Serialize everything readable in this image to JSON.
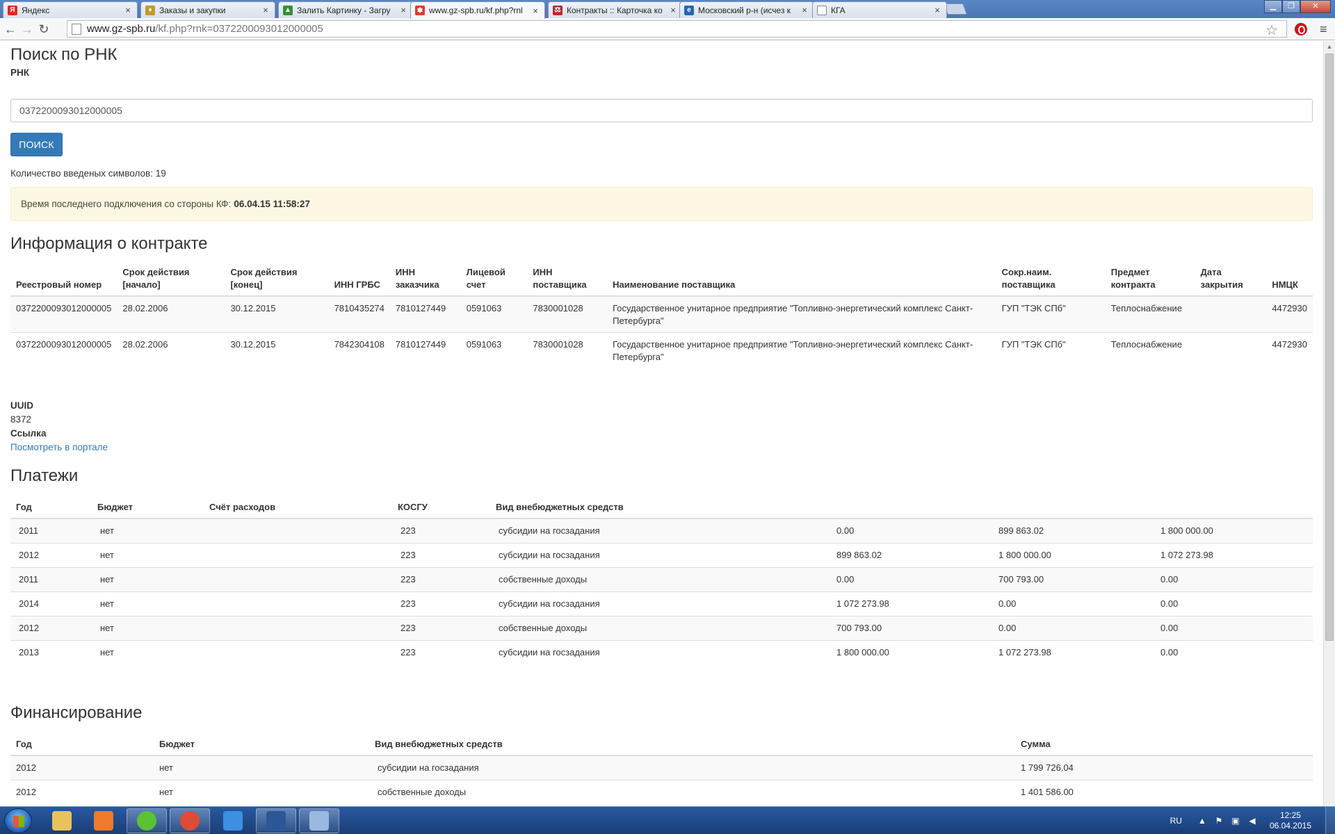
{
  "browser": {
    "tabs": [
      {
        "title": "Яндекс",
        "favicon_color": "#e52620",
        "favicon_char": "Я",
        "active": false
      },
      {
        "title": "Заказы и закупки",
        "favicon_color": "#c49a2c",
        "favicon_char": "♦",
        "active": false
      },
      {
        "title": "Залить Картинку - Загру",
        "favicon_color": "#3a8c3a",
        "favicon_char": "▲",
        "active": false
      },
      {
        "title": "www.gz-spb.ru/kf.php?rnl",
        "favicon_color": "#d6402b",
        "favicon_char": "✽",
        "active": true
      },
      {
        "title": "Контракты :: Карточка ко",
        "favicon_color": "#b03030",
        "favicon_char": "⚖",
        "active": false
      },
      {
        "title": "Московский р-н (исчез к",
        "favicon_color": "#2766b0",
        "favicon_char": "e",
        "active": false
      },
      {
        "title": "КГА",
        "favicon_color": "#ffffff",
        "favicon_char": "",
        "active": false
      }
    ],
    "url_host": "www.gz-spb.ru",
    "url_path": "/kf.php?rnk=0372200093012000005",
    "back_icon": "arrow-left-icon",
    "forward_icon": "arrow-right-icon",
    "reload_icon": "reload-icon"
  },
  "search": {
    "title": "Поиск по РНК",
    "field_label": "РНК",
    "value": "0372200093012000005",
    "button_label": "ПОИСК",
    "counter_text": "Количество введеных символов: 19",
    "alert_text": "Время последнего подключения со стороны КФ:",
    "alert_time": "06.04.15 11:58:27"
  },
  "contract": {
    "title": "Информация о контракте",
    "headers": {
      "reg": "Реестровый номер",
      "start_1": "Срок действия",
      "start_2": "[начало]",
      "end_1": "Срок действия",
      "end_2": "[конец]",
      "inn_grbs": "ИНН ГРБС",
      "inn_cust_1": "ИНН",
      "inn_cust_2": "заказчика",
      "account_1": "Лицевой",
      "account_2": "счет",
      "inn_sup_1": "ИНН",
      "inn_sup_2": "поставщика",
      "sup_name": "Наименование поставщика",
      "sup_short_1": "Сокр.наим.",
      "sup_short_2": "поставщика",
      "subject_1": "Предмет",
      "subject_2": "контракта",
      "close_1": "Дата",
      "close_2": "закрытия",
      "nmck": "НМЦК"
    },
    "rows": [
      {
        "reg": "0372200093012000005",
        "start": "28.02.2006",
        "end": "30.12.2015",
        "inn_grbs": "7810435274",
        "inn_cust": "7810127449",
        "account": "0591063",
        "inn_sup": "7830001028",
        "sup_name": "Государственное унитарное предприятие \"Топливно-энергетический комплекс Санкт-Петербурга\"",
        "sup_short": "ГУП \"ТЭК СПб\"",
        "subject": "Теплоснабжение",
        "close": "",
        "nmck": "4472930"
      },
      {
        "reg": "0372200093012000005",
        "start": "28.02.2006",
        "end": "30.12.2015",
        "inn_grbs": "7842304108",
        "inn_cust": "7810127449",
        "account": "0591063",
        "inn_sup": "7830001028",
        "sup_name": "Государственное унитарное предприятие \"Топливно-энергетический комплекс Санкт-Петербурга\"",
        "sup_short": "ГУП \"ТЭК СПб\"",
        "subject": "Теплоснабжение",
        "close": "",
        "nmck": "4472930"
      }
    ],
    "uuid_label": "UUID",
    "uuid_value": "8372",
    "link_label": "Ссылка",
    "link_text": "Посмотреть в портале"
  },
  "payments": {
    "title": "Платежи",
    "headers": {
      "year": "Год",
      "budget": "Бюджет",
      "account": "Счёт расходов",
      "kosgu": "КОСГУ",
      "kind": "Вид внебюджетных средств",
      "c6": "",
      "c7": "",
      "c8": ""
    },
    "rows": [
      {
        "year": "2011",
        "budget": "нет",
        "account": "",
        "kosgu": "223",
        "kind": "субсидии на госзадания",
        "c6": "0.00",
        "c7": "899 863.02",
        "c8": "1 800 000.00"
      },
      {
        "year": "2012",
        "budget": "нет",
        "account": "",
        "kosgu": "223",
        "kind": "субсидии на госзадания",
        "c6": "899 863.02",
        "c7": "1 800 000.00",
        "c8": "1 072 273.98"
      },
      {
        "year": "2011",
        "budget": "нет",
        "account": "",
        "kosgu": "223",
        "kind": "собственные доходы",
        "c6": "0.00",
        "c7": "700 793.00",
        "c8": "0.00"
      },
      {
        "year": "2014",
        "budget": "нет",
        "account": "",
        "kosgu": "223",
        "kind": "субсидии на госзадания",
        "c6": "1 072 273.98",
        "c7": "0.00",
        "c8": "0.00"
      },
      {
        "year": "2012",
        "budget": "нет",
        "account": "",
        "kosgu": "223",
        "kind": "собственные доходы",
        "c6": "700 793.00",
        "c7": "0.00",
        "c8": "0.00"
      },
      {
        "year": "2013",
        "budget": "нет",
        "account": "",
        "kosgu": "223",
        "kind": "субсидии на госзадания",
        "c6": "1 800 000.00",
        "c7": "1 072 273.98",
        "c8": "0.00"
      }
    ]
  },
  "financing": {
    "title": "Финансирование",
    "headers": {
      "year": "Год",
      "budget": "Бюджет",
      "kind": "Вид внебюджетных средств",
      "sum": "Сумма"
    },
    "rows": [
      {
        "year": "2012",
        "budget": "нет",
        "kind": "субсидии на госзадания",
        "sum": "1 799 726.04"
      },
      {
        "year": "2012",
        "budget": "нет",
        "kind": "собственные доходы",
        "sum": "1 401 586.00"
      }
    ]
  },
  "taskbar": {
    "apps": [
      {
        "name": "explorer",
        "color": "#e8c25a",
        "open": false
      },
      {
        "name": "media-player",
        "color": "#f07a2a",
        "open": false
      },
      {
        "name": "icq",
        "color": "#5bc236",
        "open": true
      },
      {
        "name": "chrome",
        "color": "#dd4b39",
        "open": true
      },
      {
        "name": "internet-explorer",
        "color": "#3d8fe0",
        "open": false
      },
      {
        "name": "word",
        "color": "#2b5797",
        "open": true
      },
      {
        "name": "paint",
        "color": "#9ab8e0",
        "open": true
      }
    ],
    "lang": "RU",
    "time": "12:25",
    "date": "06.04.2015"
  }
}
